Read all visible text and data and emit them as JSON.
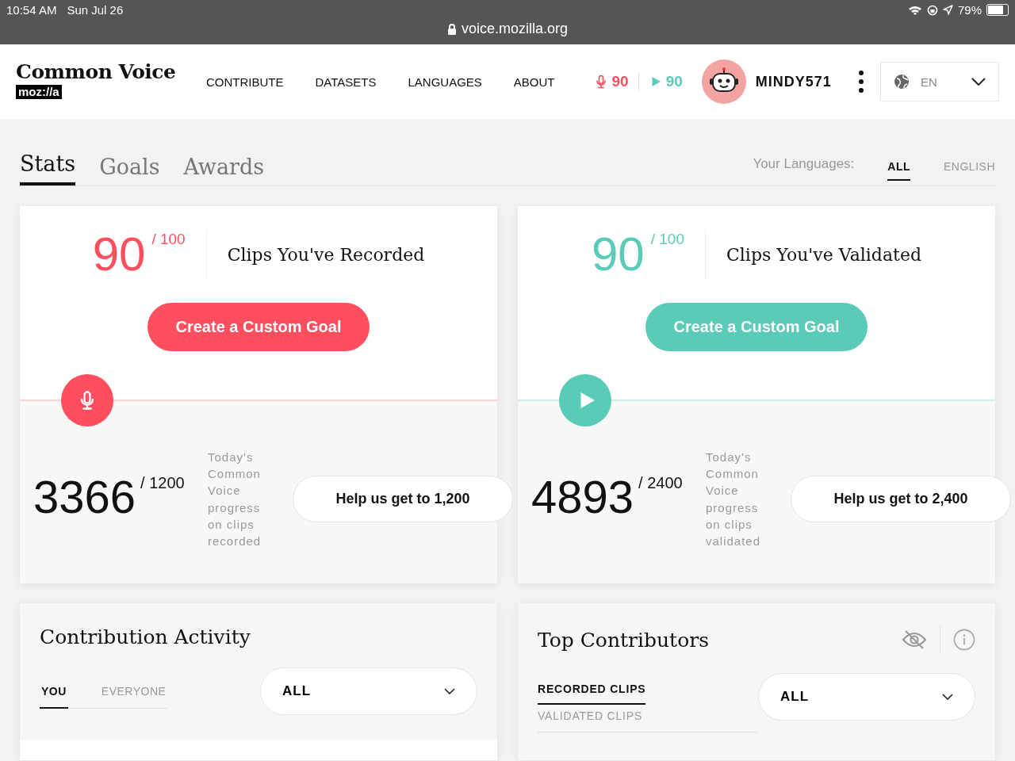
{
  "status_bar": {
    "time": "10:54 AM",
    "date": "Sun Jul 26",
    "battery": "79%"
  },
  "browser": {
    "url": "voice.mozilla.org"
  },
  "header": {
    "logo_title": "Common Voice",
    "logo_badge": "moz://a",
    "nav": [
      "CONTRIBUTE",
      "DATASETS",
      "LANGUAGES",
      "ABOUT"
    ],
    "recorded_count": "90",
    "validated_count": "90",
    "username": "MINDY571",
    "language": "EN"
  },
  "profile_tabs": [
    {
      "label": "Stats",
      "selected": true
    },
    {
      "label": "Goals",
      "selected": false
    },
    {
      "label": "Awards",
      "selected": false
    }
  ],
  "languages": {
    "label": "Your Languages:",
    "options": [
      {
        "label": "ALL",
        "selected": true
      },
      {
        "label": "ENGLISH",
        "selected": false
      }
    ]
  },
  "goal_cards": [
    {
      "kind": "record",
      "count": "90",
      "total": "/ 100",
      "title": "Clips You've Recorded",
      "button": "Create a Custom Goal",
      "today_count": "3366",
      "today_total": "/ 1200",
      "description": "Today's Common Voice progress on clips recorded",
      "help_button": "Help us get to 1,200"
    },
    {
      "kind": "validate",
      "count": "90",
      "total": "/ 100",
      "title": "Clips You've Validated",
      "button": "Create a Custom Goal",
      "today_count": "4893",
      "today_total": "/ 2400",
      "description": "Today's Common Voice progress on clips validated",
      "help_button": "Help us get to 2,400"
    }
  ],
  "contribution_activity": {
    "title": "Contribution Activity",
    "tabs": [
      {
        "label": "YOU",
        "selected": true
      },
      {
        "label": "EVERYONE",
        "selected": false
      }
    ],
    "dropdown": "ALL"
  },
  "top_contributors": {
    "title": "Top Contributors",
    "tabs": [
      {
        "label": "RECORDED CLIPS",
        "selected": true
      },
      {
        "label": "VALIDATED CLIPS",
        "selected": false
      }
    ],
    "dropdown": "ALL"
  }
}
